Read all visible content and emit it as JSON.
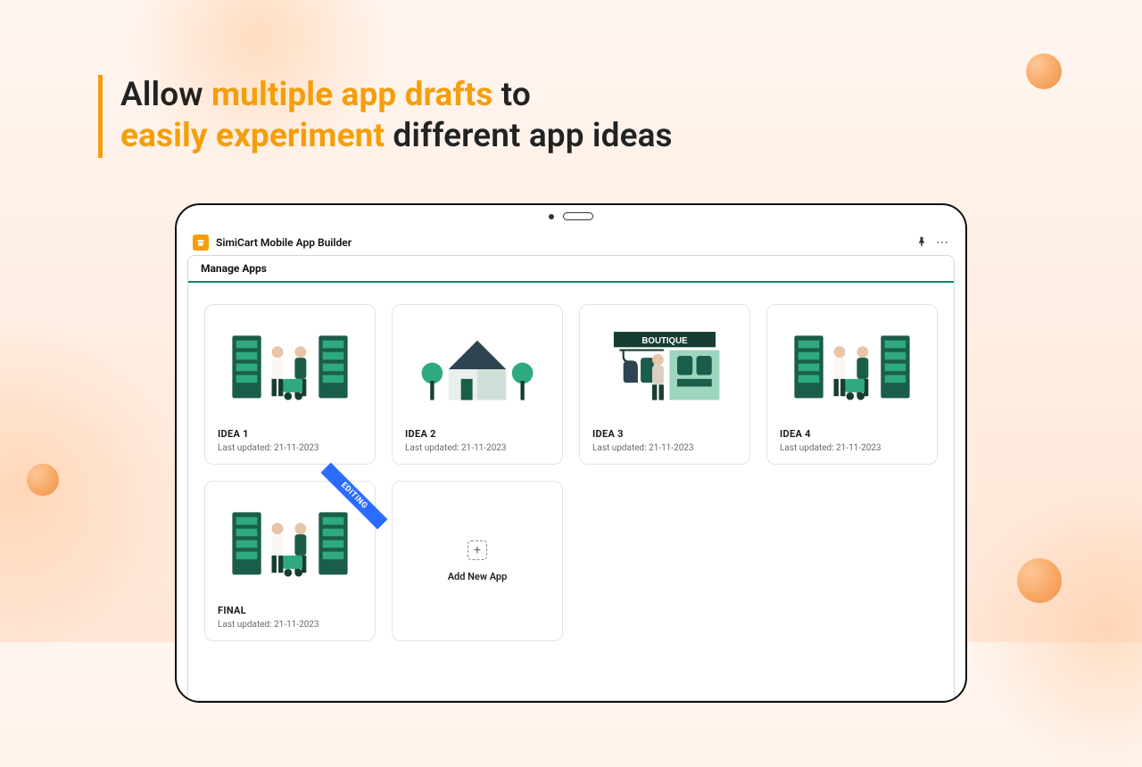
{
  "headline": {
    "part1": "Allow ",
    "highlight1": "multiple app drafts",
    "part2": " to",
    "highlight2": "easily experiment",
    "part3": " different app ideas"
  },
  "titlebar": {
    "brand": "SimiCart Mobile App Builder"
  },
  "section": {
    "tab": "Manage Apps"
  },
  "cards": [
    {
      "title": "IDEA 1",
      "sub": "Last updated: 21-11-2023",
      "ribbon": null,
      "illustration": "shop"
    },
    {
      "title": "IDEA 2",
      "sub": "Last updated: 21-11-2023",
      "ribbon": null,
      "illustration": "house"
    },
    {
      "title": "IDEA 3",
      "sub": "Last updated: 21-11-2023",
      "ribbon": null,
      "illustration": "boutique"
    },
    {
      "title": "IDEA 4",
      "sub": "Last updated: 21-11-2023",
      "ribbon": null,
      "illustration": "shop"
    },
    {
      "title": "FINAL",
      "sub": "Last updated: 21-11-2023",
      "ribbon": "EDITING",
      "illustration": "shop"
    }
  ],
  "add": {
    "label": "Add New App"
  }
}
